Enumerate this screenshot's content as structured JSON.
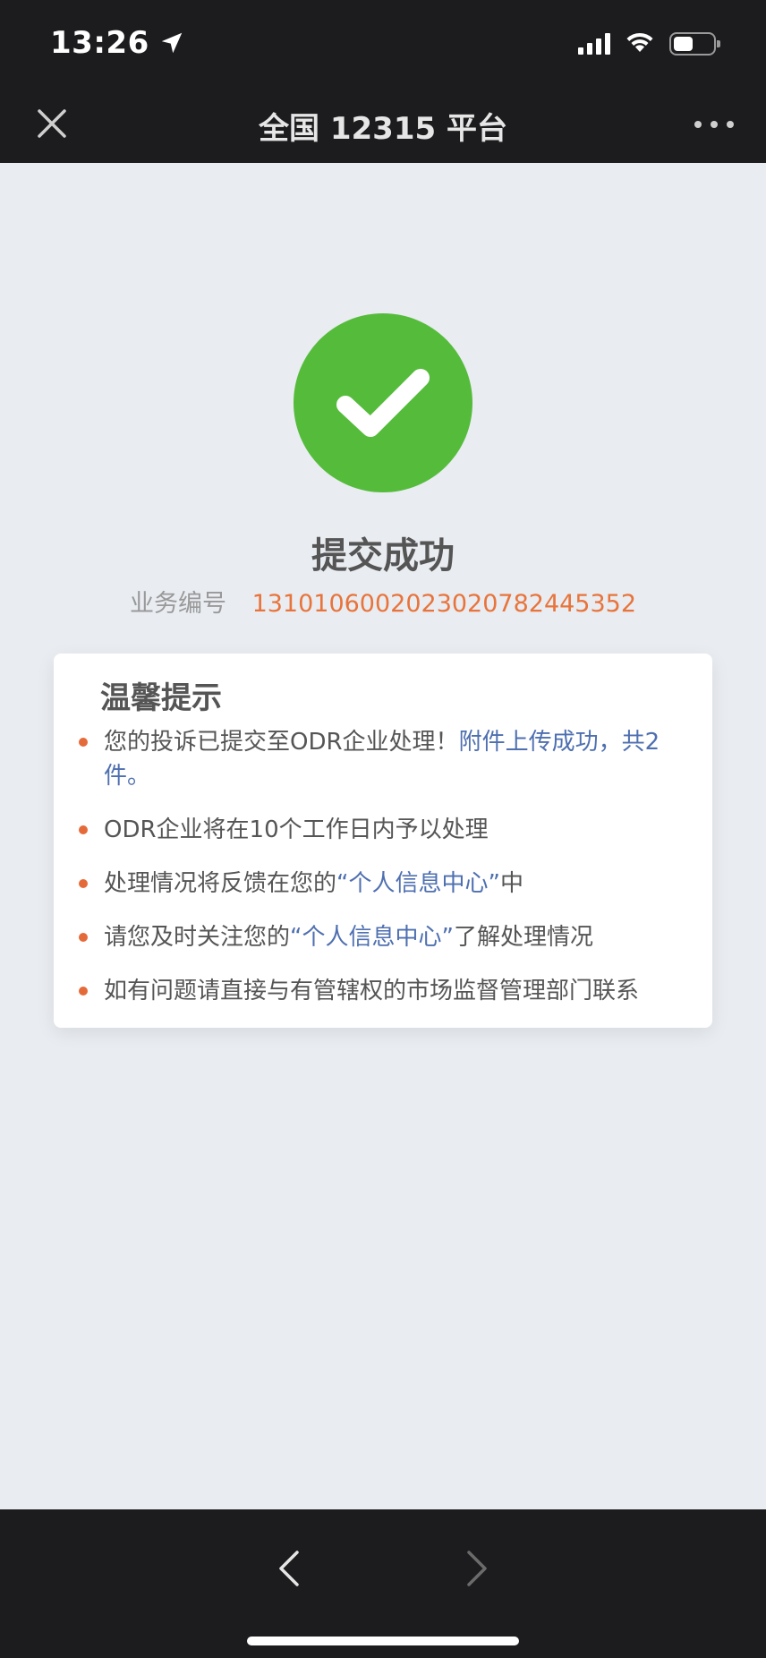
{
  "status": {
    "time": "13:26",
    "battery_level": 0.5
  },
  "nav": {
    "title": "全国 12315 平台"
  },
  "result": {
    "title": "提交成功",
    "biz_label": "业务编号",
    "biz_number": "13101060020230207824453​52"
  },
  "tips": {
    "title": "温馨提示",
    "items": [
      {
        "text": "您的投诉已提交至ODR企业处理！",
        "link": "附件上传成功，共2件。",
        "after": ""
      },
      {
        "text": "ODR企业将在10个工作日内予以处理",
        "link": "",
        "after": ""
      },
      {
        "text": "处理情况将反馈在您的",
        "link": "“个人信息中心”",
        "after": "中"
      },
      {
        "text": "请您及时关注您的",
        "link": "“个人信息中心”",
        "after": "了解处理情况"
      },
      {
        "text": "如有问题请直接与有管辖权的市场监督管理部门联系",
        "link": "",
        "after": ""
      }
    ]
  },
  "colors": {
    "accent_green": "#55bc3b",
    "biz_number_orange": "#e8743b",
    "link_blue": "#4e6fb0",
    "bullet_orange": "#e56a3a"
  },
  "icons": {
    "close": "close-icon",
    "more": "more-icon",
    "success": "checkmark-icon",
    "back": "chevron-left-icon",
    "forward": "chevron-right-icon"
  }
}
